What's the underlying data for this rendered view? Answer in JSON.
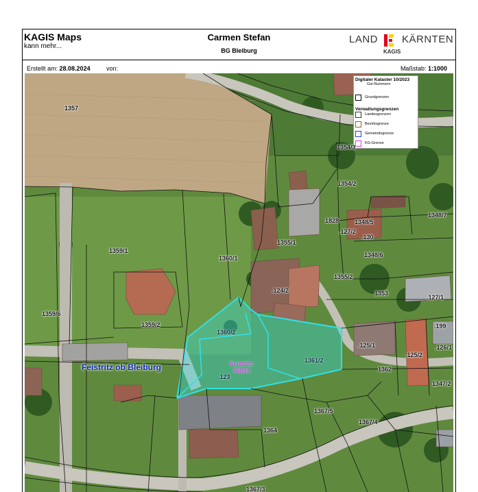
{
  "header": {
    "app_title": "KAGIS Maps",
    "app_subtitle": "kann mehr...",
    "person": "Carmen Stefan",
    "office": "BG Bleiburg",
    "logo": {
      "land": "LAND",
      "kaernten": "KÄRNTEN",
      "kagis": "KAGIS",
      "colors": [
        "#e3001b",
        "#ffd100"
      ]
    }
  },
  "meta": {
    "created_label": "Erstellt am:",
    "created_date": "28.08.2024",
    "von_label": "von:",
    "scale_label": "Maßstab:",
    "scale_value": "1:1000"
  },
  "legend": {
    "title": "Digitaler Kataster 10/2023",
    "subtitle": "Gst-Nummern",
    "grundgrenzen": "Grundgrenzen",
    "verwaltung_title": "Verwaltungsgrenzen",
    "items": [
      {
        "label": "Landesgrenzen",
        "color": "#333333"
      },
      {
        "label": "Bezirksgrenze",
        "color": "#9a5a30"
      },
      {
        "label": "Gemeindegrenze",
        "color": "#2a3fd0"
      },
      {
        "label": "KG-Grenze",
        "color": "#d43cd8"
      }
    ]
  },
  "map": {
    "place_name": "Feistritz ob Bleiburg",
    "kg": {
      "name": "Feistritz",
      "number": "76004"
    },
    "highlight_color": "#2fe0e6",
    "parcels": [
      "1357",
      "1354/3",
      "1354/2",
      "1828",
      "1348/5",
      "1348/7",
      ".127/2",
      ".130",
      "1348/6",
      "1359/1",
      "1360/1",
      "1355/1",
      "1355/2",
      ".124/2",
      "1353",
      ".127/1",
      "1359/6",
      "1359/2",
      "1360/2",
      ".199",
      ".125/1",
      ".125/2",
      ".126/1",
      "1361/2",
      "1362",
      ".123",
      "1347/2",
      "1367/5",
      "1367/4",
      "1364",
      "1367/3"
    ]
  }
}
